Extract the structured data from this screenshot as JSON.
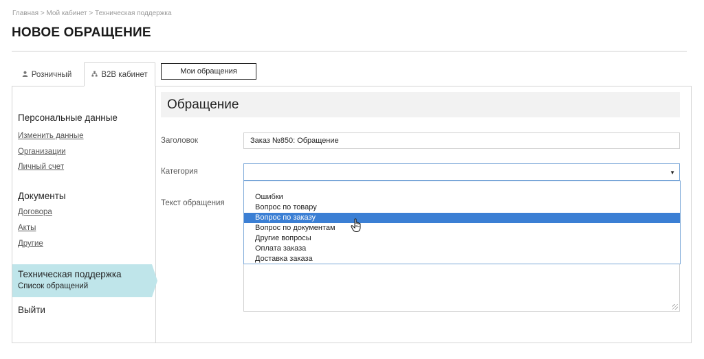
{
  "breadcrumb": "Главная > Мой кабинет > Техническая поддержка",
  "page_title": "НОВОЕ ОБРАЩЕНИЕ",
  "tabs": [
    {
      "label": "Розничный",
      "icon": "person-icon"
    },
    {
      "label": "B2B кабинет",
      "icon": "org-icon"
    }
  ],
  "my_requests_button": "Мои обращения",
  "sidebar": {
    "sections": [
      {
        "title": "Персональные данные",
        "links": [
          "Изменить данные",
          "Организации",
          "Личный счет"
        ]
      },
      {
        "title": "Документы",
        "links": [
          "Договора",
          "Акты",
          "Другие"
        ]
      }
    ],
    "active": {
      "title": "Техническая поддержка",
      "sub": "Список обращений"
    },
    "logout": "Выйти"
  },
  "form": {
    "header": "Обращение",
    "title_label": "Заголовок",
    "title_value": "Заказ №850: Обращение",
    "category_label": "Категория",
    "category_value": "",
    "text_label": "Текст обращения"
  },
  "dropdown": {
    "options": [
      "",
      "Ошибки",
      "Вопрос по товару",
      "Вопрос по заказу",
      "Вопрос по документам",
      "Другие вопросы",
      "Оплата заказа",
      "Доставка заказа"
    ],
    "highlighted": "Вопрос по заказу"
  },
  "colors": {
    "accent": "#3b7fd4",
    "active_bg": "#bfe5ea"
  }
}
